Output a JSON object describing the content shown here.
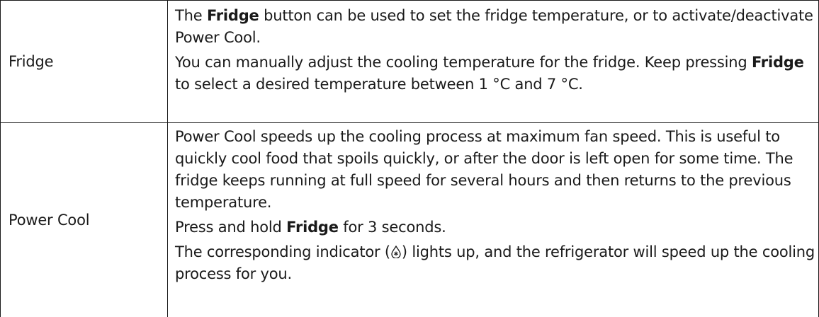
{
  "rows": [
    {
      "feature": "Fridge",
      "p1": {
        "a": "The ",
        "kw": "Fridge",
        "b": " button can be used to set the fridge temperature, or to activate/deactivate Power Cool."
      },
      "p2": {
        "a": "You can manually adjust the cooling temperature for the fridge. Keep pressing ",
        "kw": "Fridge",
        "b": " to select a desired temperature between 1 °C and 7 °C."
      }
    },
    {
      "feature": "Power Cool",
      "p1": "Power Cool speeds up the cooling process at maximum fan speed. This is useful to quickly cool food that spoils quickly, or after the door is left open for some time. The fridge keeps running at full speed for several hours and then returns to the previous temperature.",
      "p2": {
        "a": "Press and hold ",
        "kw": "Fridge",
        "b": " for 3 seconds."
      },
      "p3": {
        "a": "The corresponding indicator (",
        "icon": "power-cool-indicator-icon",
        "b": ") lights up, and the refrigerator will speed up the cooling process for you."
      }
    }
  ]
}
